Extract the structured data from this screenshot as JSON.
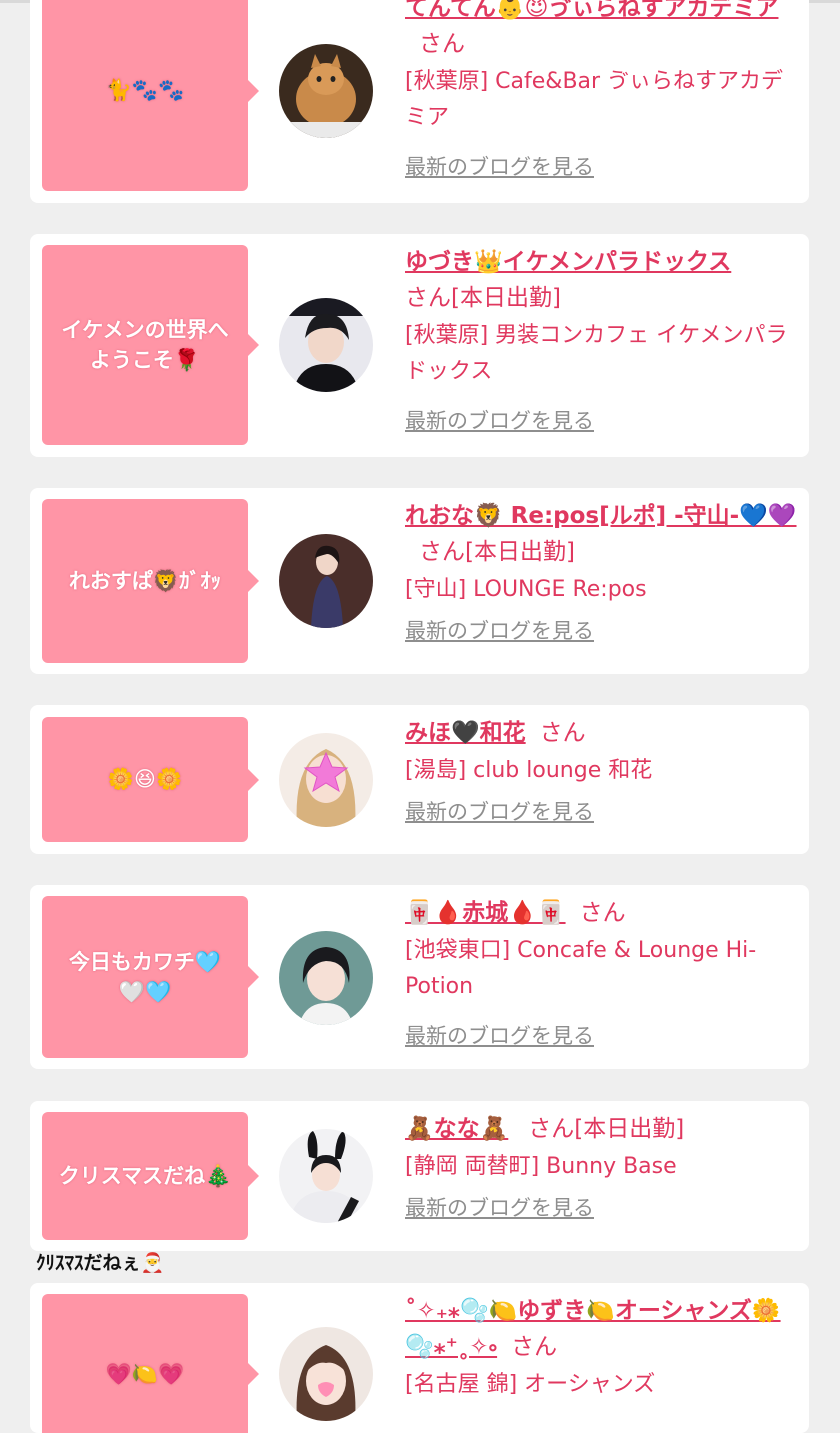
{
  "cards": [
    {
      "catchphrase": "🐈🐾🐾",
      "name": "てんてん👶😈ゔぃらねすアカデミア",
      "honorific": "さん",
      "status": "",
      "shop": "[秋葉原] Cafe&Bar ゔぃらねすアカデミア",
      "blog_link": "最新のブログを見る"
    },
    {
      "catchphrase": "イケメンの世界へ\nようこそ🌹",
      "name": "ゆづき👑イケメンパラドックス",
      "honorific": "さん",
      "status": "[本日出勤]",
      "shop": "[秋葉原] 男装コンカフェ イケメンパラドックス",
      "blog_link": "最新のブログを見る"
    },
    {
      "catchphrase": "れおすぱ🦁ｶﾞｵｯ",
      "name": "れおな🦁 Re:pos[ルポ] -守山-💙💜",
      "honorific": "さん",
      "status": "[本日出勤]",
      "shop": "[守山] LOUNGE Re:pos",
      "blog_link": "最新のブログを見る"
    },
    {
      "catchphrase": "🌼😆🌼",
      "name": "みほ🖤和花",
      "honorific": "さん",
      "status": "",
      "shop": "[湯島] club lounge 和花",
      "blog_link": "最新のブログを見る"
    },
    {
      "catchphrase": "今日もカワチ🩵\n🤍🩵",
      "name": "🀄🩸赤城🩸🀄",
      "honorific": "さん",
      "status": "",
      "shop": "[池袋東口] Concafe & Lounge Hi-Potion",
      "blog_link": "最新のブログを見る"
    },
    {
      "catchphrase": "クリスマスだね🎄",
      "name": "🧸なな🧸",
      "honorific": "さん",
      "status": "[本日出勤]",
      "shop": "[静岡 両替町] Bunny Base",
      "blog_link": "最新のブログを見る"
    },
    {
      "catchphrase": "💗🍋💗",
      "name": "˚✧₊⁎🫧🍋ゆずき🍋オーシャンズ🌼🫧⁎⁺˳✧༚",
      "honorific": "さん",
      "status": "",
      "shop": "[名古屋 錦] オーシャンズ",
      "blog_link": ""
    }
  ],
  "caption": "ｸﾘｽﾏｽだねぇ🎅",
  "colors": {
    "accent": "#e0385f",
    "bubble": "#ff95a6",
    "muted": "#8e8e8e",
    "background": "#efefef"
  }
}
